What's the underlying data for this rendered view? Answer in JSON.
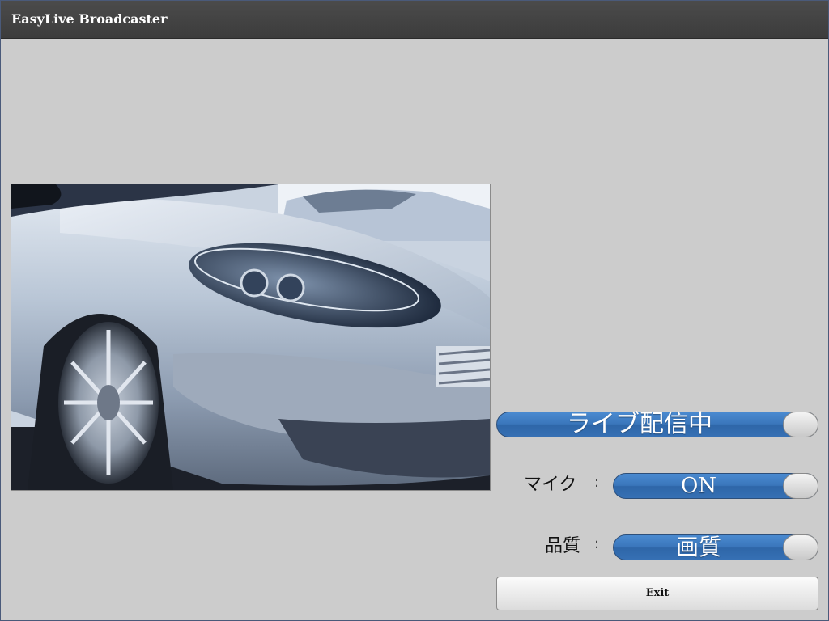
{
  "app": {
    "title": "EasyLive Broadcaster"
  },
  "controls": {
    "live": {
      "label": "ライブ配信中"
    },
    "mic": {
      "row_label": "マイク",
      "colon": ":",
      "value": "ON"
    },
    "quality": {
      "row_label": "品質",
      "colon": ":",
      "value": "画質"
    },
    "exit_label": "Exit"
  },
  "colors": {
    "titlebar": "#444444",
    "background": "#cccccc",
    "toggle_on": "#3a76bb"
  }
}
